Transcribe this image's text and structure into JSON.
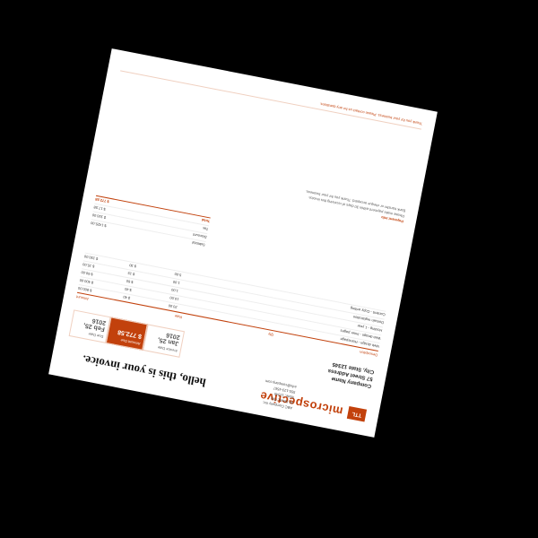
{
  "brand": {
    "logo": "TTL",
    "name": "microspective"
  },
  "heading": "hello, this is your invoice.",
  "sender": [
    "ABC Company Inc.",
    "45 Street, City",
    "State, 12345",
    "555-123-4567",
    "info@company.com"
  ],
  "client": [
    "Company Name",
    "57 Street Address",
    "City, State 12345"
  ],
  "meta": [
    {
      "label": "Invoice Date",
      "value": "Jan 25, 2016"
    },
    {
      "label": "Amount Due",
      "value": "$ 772.58"
    },
    {
      "label": "Due Date",
      "value": "Feb 25, 2016"
    }
  ],
  "table_headers": [
    "Description",
    "Qty",
    "Rate",
    "Amount"
  ],
  "items": [
    {
      "desc": "Web design - Homepage",
      "qty": "20.00",
      "rate": "$ 40",
      "amount": "$ 800.00"
    },
    {
      "desc": "Web design - Inner pages",
      "qty": "10.00",
      "rate": "$ 40",
      "amount": "$ 400.00"
    },
    {
      "desc": "Hosting - 1 year",
      "qty": "1.00",
      "rate": "$ 60",
      "amount": "$ 60.00"
    },
    {
      "desc": "Domain registration",
      "qty": "1.00",
      "rate": "$ 15",
      "amount": "$ 15.00"
    },
    {
      "desc": "Content - Copy writing",
      "qty": "5.00",
      "rate": "$ 30",
      "amount": "$ 150.00"
    }
  ],
  "totals": [
    {
      "label": "Subtotal",
      "value": "$ 1425.00"
    },
    {
      "label": "Discount",
      "value": "$ 100.00"
    },
    {
      "label": "Tax",
      "value": "$ 17.58"
    },
    {
      "label": "Total",
      "value": "$ 772.58",
      "highlight": true
    }
  ],
  "notes": {
    "heading": "Payment info",
    "lines": [
      "Please make payment within 30 days of receiving this invoice.",
      "Bank transfer or cheque accepted. Thank you for your business."
    ]
  },
  "footer": "Thank you for your business. Please contact us for any questions."
}
